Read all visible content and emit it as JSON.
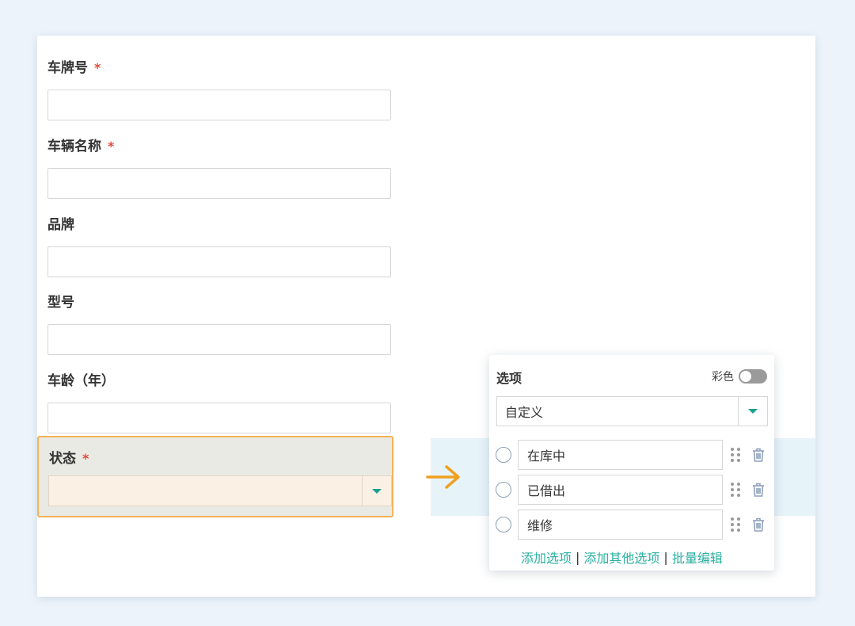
{
  "form": {
    "fields": [
      {
        "label": "车牌号",
        "required": "*"
      },
      {
        "label": "车辆名称",
        "required": "*"
      },
      {
        "label": "品牌"
      },
      {
        "label": "型号"
      },
      {
        "label": "车龄（年）"
      }
    ],
    "status": {
      "label": "状态",
      "required": "*",
      "value": ""
    }
  },
  "panel": {
    "title": "选项",
    "color_label": "彩色",
    "color_enabled": false,
    "type_value": "自定义",
    "options": [
      "在库中",
      "已借出",
      "维修"
    ],
    "links": {
      "add_option": "添加选项",
      "separator": "|",
      "add_other": "添加其他选项",
      "batch_edit": "批量编辑"
    }
  },
  "colors": {
    "accent": "#1aa092",
    "link": "#2ab0a0",
    "required": "#e64a3b",
    "highlight_border": "#f5b25a",
    "arrow": "#f0a020"
  },
  "icons": [
    "chevron-down-icon",
    "arrow-right-icon",
    "drag-handle-icon",
    "trash-icon",
    "toggle-switch"
  ]
}
